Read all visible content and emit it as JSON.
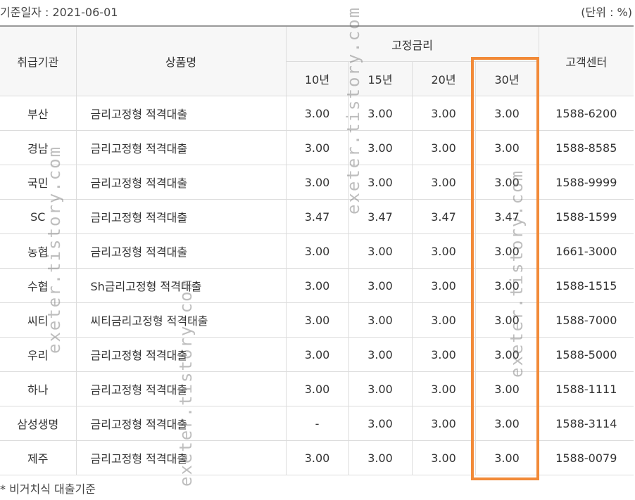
{
  "meta": {
    "date_label": "기준일자 : 2021-06-01",
    "unit_label": "(단위 : %)"
  },
  "table": {
    "headers": {
      "institution": "취급기관",
      "product": "상품명",
      "fixed_rate": "고정금리",
      "contact": "고객센터",
      "terms": [
        "10년",
        "15년",
        "20년",
        "30년"
      ]
    },
    "rows": [
      {
        "institution": "부산",
        "product": "금리고정형 적격대출",
        "rates": [
          "3.00",
          "3.00",
          "3.00",
          "3.00"
        ],
        "phone": "1588-6200"
      },
      {
        "institution": "경남",
        "product": "금리고정형 적격대출",
        "rates": [
          "3.00",
          "3.00",
          "3.00",
          "3.00"
        ],
        "phone": "1588-8585"
      },
      {
        "institution": "국민",
        "product": "금리고정형 적격대출",
        "rates": [
          "3.00",
          "3.00",
          "3.00",
          "3.00"
        ],
        "phone": "1588-9999"
      },
      {
        "institution": "SC",
        "product": "금리고정형 적격대출",
        "rates": [
          "3.47",
          "3.47",
          "3.47",
          "3.47"
        ],
        "phone": "1588-1599"
      },
      {
        "institution": "농협",
        "product": "금리고정형 적격대출",
        "rates": [
          "3.00",
          "3.00",
          "3.00",
          "3.00"
        ],
        "phone": "1661-3000"
      },
      {
        "institution": "수협",
        "product": "Sh금리고정형 적격대출",
        "rates": [
          "3.00",
          "3.00",
          "3.00",
          "3.00"
        ],
        "phone": "1588-1515"
      },
      {
        "institution": "씨티",
        "product": "씨티금리고정형 적격대출",
        "rates": [
          "3.00",
          "3.00",
          "3.00",
          "3.00"
        ],
        "phone": "1588-7000"
      },
      {
        "institution": "우리",
        "product": "금리고정형 적격대출",
        "rates": [
          "3.00",
          "3.00",
          "3.00",
          "3.00"
        ],
        "phone": "1588-5000"
      },
      {
        "institution": "하나",
        "product": "금리고정형 적격대출",
        "rates": [
          "3.00",
          "3.00",
          "3.00",
          "3.00"
        ],
        "phone": "1588-1111"
      },
      {
        "institution": "삼성생명",
        "product": "금리고정형 적격대출",
        "rates": [
          "-",
          "3.00",
          "3.00",
          "3.00"
        ],
        "phone": "1588-3114"
      },
      {
        "institution": "제주",
        "product": "금리고정형 적격대출",
        "rates": [
          "3.00",
          "3.00",
          "3.00",
          "3.00"
        ],
        "phone": "1588-0079"
      }
    ]
  },
  "footnote": "* 비거치식 대출기준",
  "watermark": "exeter.tistory.com",
  "colors": {
    "highlight": "#f28a38",
    "header_bg": "#f7f7f7",
    "border": "#dcdcdc"
  }
}
